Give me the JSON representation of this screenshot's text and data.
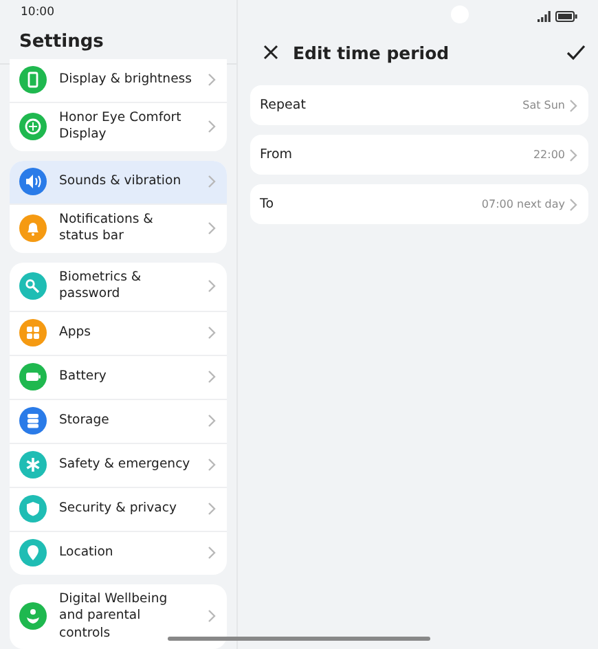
{
  "status_bar": {
    "time": "10:00"
  },
  "sidebar": {
    "title": "Settings",
    "groups": [
      {
        "items": [
          {
            "label": "Display & brightness",
            "color": "#1fb84f",
            "selected": false
          },
          {
            "label": "Honor Eye Comfort Display",
            "color": "#1fb84f",
            "selected": false
          }
        ]
      },
      {
        "items": [
          {
            "label": "Sounds & vibration",
            "color": "#2a7be8",
            "selected": true
          },
          {
            "label": "Notifications & status bar",
            "color": "#f59a12",
            "selected": false
          }
        ]
      },
      {
        "items": [
          {
            "label": "Biometrics & password",
            "color": "#1fbdb4",
            "selected": false
          },
          {
            "label": "Apps",
            "color": "#f59a12",
            "selected": false
          },
          {
            "label": "Battery",
            "color": "#1fb84f",
            "selected": false
          },
          {
            "label": "Storage",
            "color": "#2a7be8",
            "selected": false
          },
          {
            "label": "Safety & emergency",
            "color": "#1fbdb4",
            "selected": false
          },
          {
            "label": "Security & privacy",
            "color": "#1fbdb4",
            "selected": false
          },
          {
            "label": "Location",
            "color": "#1fbdb4",
            "selected": false
          }
        ]
      },
      {
        "items": [
          {
            "label": "Digital Wellbeing and parental controls",
            "color": "#1fb84f",
            "selected": false
          }
        ]
      }
    ]
  },
  "detail": {
    "title": "Edit time period",
    "rows": [
      {
        "label": "Repeat",
        "value": "Sat Sun"
      },
      {
        "label": "From",
        "value": "22:00"
      },
      {
        "label": "To",
        "value": "07:00 next day"
      }
    ]
  }
}
